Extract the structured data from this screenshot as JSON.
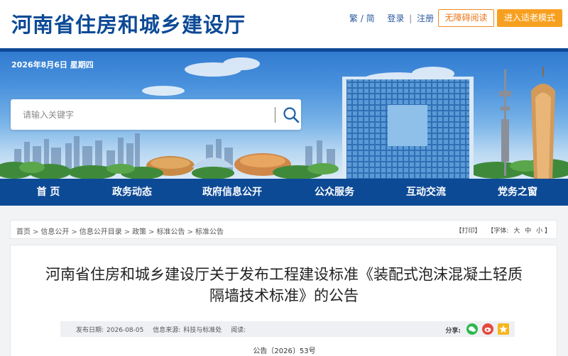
{
  "header": {
    "site_title": "河南省住房和城乡建设厅",
    "links": {
      "lang": "繁 / 简",
      "login": "登录",
      "sep": "|",
      "register": "注册"
    },
    "accessible_btn": "无障碍阅读",
    "elder_btn": "进入适老模式",
    "colors": {
      "brand": "#0d4a96",
      "accent": "#f7a020"
    }
  },
  "banner": {
    "date": "2026年8月6日 星期四",
    "search": {
      "placeholder": "请输入关键字",
      "icon": "search-icon"
    }
  },
  "nav": {
    "items": [
      {
        "label": "首 页"
      },
      {
        "label": "政务动态"
      },
      {
        "label": "政府信息公开"
      },
      {
        "label": "公众服务"
      },
      {
        "label": "互动交流"
      },
      {
        "label": "党务之窗"
      }
    ]
  },
  "breadcrumb": {
    "items": [
      "首页",
      "信息公开",
      "信息公开目录",
      "政策",
      "标准公告",
      "标准公告"
    ],
    "separator": ">",
    "print": "【打印】",
    "font_label": "【字体:",
    "sizes": [
      "大",
      "中",
      "小"
    ],
    "font_close": "】"
  },
  "article": {
    "title": "河南省住房和城乡建设厅关于发布工程建设标准《装配式泡沫混凝土轻质隔墙技术标准》的公告",
    "meta": {
      "date_label": "发布日期:",
      "date": "2026-08-05",
      "source_label": "信息来源:",
      "source": "科技与标准处",
      "reads_label": "阅读:"
    },
    "share_label": "分享:",
    "share_icons": [
      "wechat-icon",
      "weibo-icon",
      "qzone-icon"
    ],
    "doc_number": "公告〔2026〕53号"
  }
}
